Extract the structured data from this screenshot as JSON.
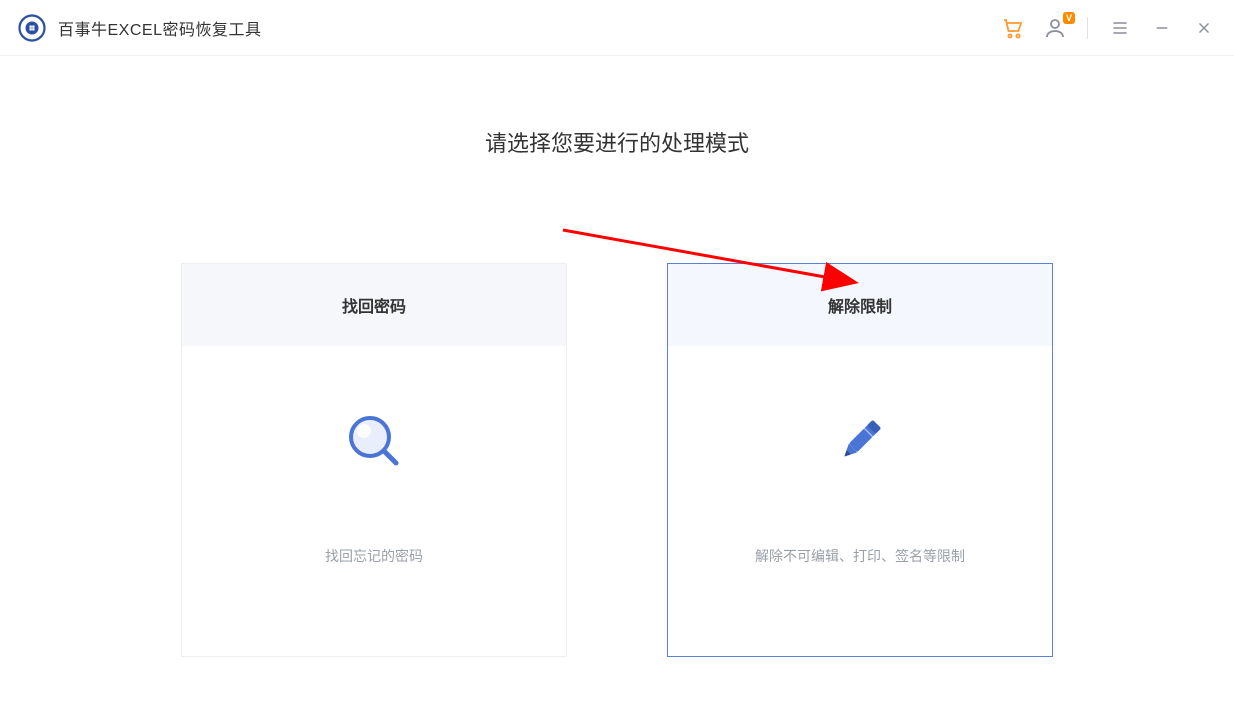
{
  "app": {
    "title": "百事牛EXCEL密码恢复工具"
  },
  "titlebar": {
    "user_badge": "V"
  },
  "main": {
    "heading": "请选择您要进行的处理模式",
    "cards": [
      {
        "title": "找回密码",
        "desc": "找回忘记的密码",
        "selected": false
      },
      {
        "title": "解除限制",
        "desc": "解除不可编辑、打印、签名等限制",
        "selected": true
      }
    ]
  }
}
